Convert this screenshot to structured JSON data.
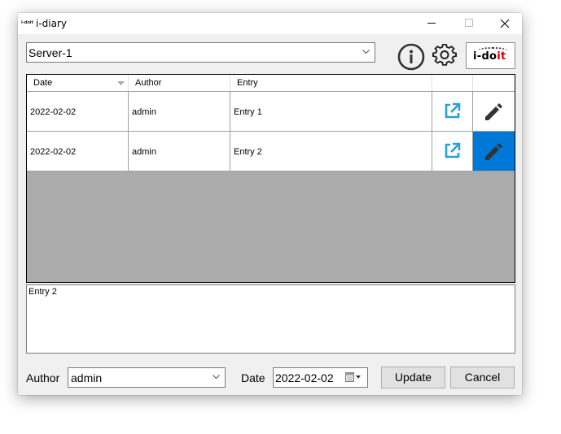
{
  "window": {
    "app_icon_text": "i-doit",
    "title": "i-diary"
  },
  "toolbar": {
    "server_selected": "Server-1",
    "info_icon": "info-circle-icon",
    "settings_icon": "gear-icon",
    "logo": {
      "prefix": "i-do",
      "suffix": "it",
      "suffix_color": "#d50000"
    }
  },
  "grid": {
    "columns": [
      "Date",
      "Author",
      "Entry",
      "",
      ""
    ],
    "rows": [
      {
        "date": "2022-02-02",
        "author": "admin",
        "entry": "Entry 1",
        "open_icon": "external-link-icon",
        "edit_icon": "pencil-icon",
        "selected": false
      },
      {
        "date": "2022-02-02",
        "author": "admin",
        "entry": "Entry 2",
        "open_icon": "external-link-icon",
        "edit_icon": "pencil-icon",
        "selected": true
      }
    ],
    "accent_color": "#2a9fd8",
    "selection_color": "#0078d7"
  },
  "detail": {
    "text": "Entry 2"
  },
  "footer": {
    "author_label": "Author",
    "author_value": "admin",
    "date_label": "Date",
    "date_value": "2022-02-02",
    "update_label": "Update",
    "cancel_label": "Cancel"
  }
}
